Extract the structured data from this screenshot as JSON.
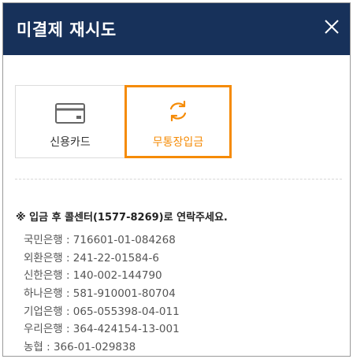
{
  "dialog": {
    "title": "미결제 재시도",
    "close_icon": "close-icon"
  },
  "methods": [
    {
      "label": "신용카드",
      "icon": "credit-card-icon",
      "selected": false
    },
    {
      "label": "무통장입금",
      "icon": "refresh-icon",
      "selected": true
    }
  ],
  "notice": "※ 입금 후 콜센터(1577-8269)로 연락주세요.",
  "accounts": [
    "국민은행 : 716601-01-084268",
    "외환은행 : 241-22-01584-6",
    "신한은행 : 140-002-144790",
    "하나은행 : 581-910001-80704",
    "기업은행 : 065-055398-04-011",
    "우리은행 : 364-424154-13-001",
    "농협 : 366-01-029838"
  ],
  "colors": {
    "header_bg": "#17315a",
    "accent": "#f58b06",
    "text": "#333333"
  }
}
